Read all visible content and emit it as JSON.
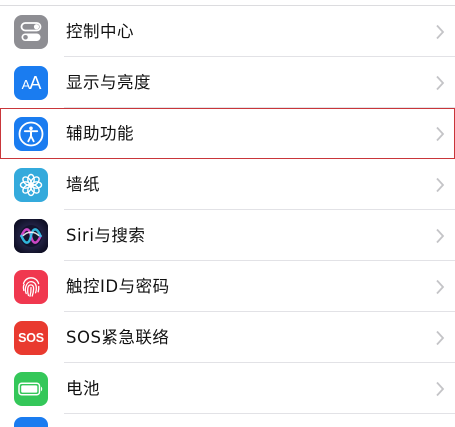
{
  "settings": {
    "rows": [
      {
        "label": "控制中心",
        "icon": "control-center-icon",
        "color": "#8e8e93"
      },
      {
        "label": "显示与亮度",
        "icon": "display-brightness-icon",
        "color": "#1a7cf0",
        "glyph": "AA"
      },
      {
        "label": "辅助功能",
        "icon": "accessibility-icon",
        "color": "#1a7cf0"
      },
      {
        "label": "墙纸",
        "icon": "wallpaper-icon",
        "color": "#34aadc"
      },
      {
        "label": "Siri与搜索",
        "icon": "siri-icon",
        "color": "#1c1c3c"
      },
      {
        "label": "触控ID与密码",
        "icon": "fingerprint-icon",
        "color": "#f0384f"
      },
      {
        "label": "SOS紧急联络",
        "icon": "sos-icon",
        "color": "#e93a2f",
        "glyph": "SOS"
      },
      {
        "label": "电池",
        "icon": "battery-icon",
        "color": "#34c759"
      }
    ],
    "highlight_color": "#c9363a"
  }
}
